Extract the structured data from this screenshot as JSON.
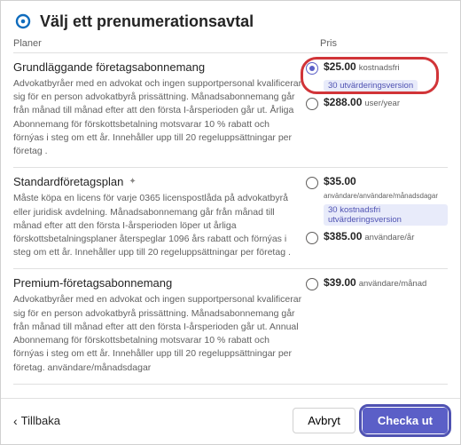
{
  "header": {
    "title": "Välj ett prenumerationsavtal"
  },
  "columns": {
    "plan": "Planer",
    "price": "Pris"
  },
  "plans": [
    {
      "name": "Grundläggande företagsabonnemang",
      "desc": "Advokatbyråer med en advokat och ingen supportpersonal kvalificerar sig för en person advokatbyrå prissättning. Månadsabonnemang går från månad till månad efter att den första I-årsperioden går ut. Årliga Abonnemang för förskottsbetalning motsvarar 10 % rabatt och förnýas i steg om ett år. Innehåller upp till 20 regeluppsättningar per företag .",
      "options": [
        {
          "amount": "$25.00",
          "unit": "kostnadsfri",
          "selected": true,
          "trial": "30 utvärderingsversion"
        },
        {
          "amount": "$288.00",
          "unit": "user/year",
          "selected": false
        }
      ]
    },
    {
      "name": "Standardföretagsplan",
      "desc": "Måste köpa en licens för varje 0365 licenspostlåda på advokatbyrå eller juridisk avdelning. Månadsabonnemang går från månad till månad efter att den första I-årsperioden löper ut årliga förskottsbetalningsplaner återspeglar 1096 års rabatt och förnýas i steg om ett år. Innehåller upp till 20 regeluppsättningar per företag .",
      "options": [
        {
          "amount": "$35.00",
          "unit": "användare/användare/månadsdagar",
          "selected": false,
          "trial": "30 kostnadsfri utvärderingsversion"
        },
        {
          "amount": "$385.00",
          "unit": "användare/år",
          "selected": false
        }
      ]
    },
    {
      "name": "Premium-företagsabonnemang",
      "desc": "Advokatbyråer med en advokat och ingen supportpersonal kvalificerar sig för en person advokatbyrå prissättning. Månadsabonnemang går från månad till månad efter att den första I-årsperioden går ut. Annual Abonnemang för förskottsbetalning motsvarar 10 % rabatt och förnýas i steg om ett år. Innehåller upp till 20 regeluppsättningar per företag. användare/månadsdagar",
      "options": [
        {
          "amount": "$39.00",
          "unit": "användare/månad",
          "selected": false
        }
      ]
    }
  ],
  "footer": {
    "back": "Tillbaka",
    "cancel": "Avbryt",
    "checkout": "Checka ut"
  }
}
